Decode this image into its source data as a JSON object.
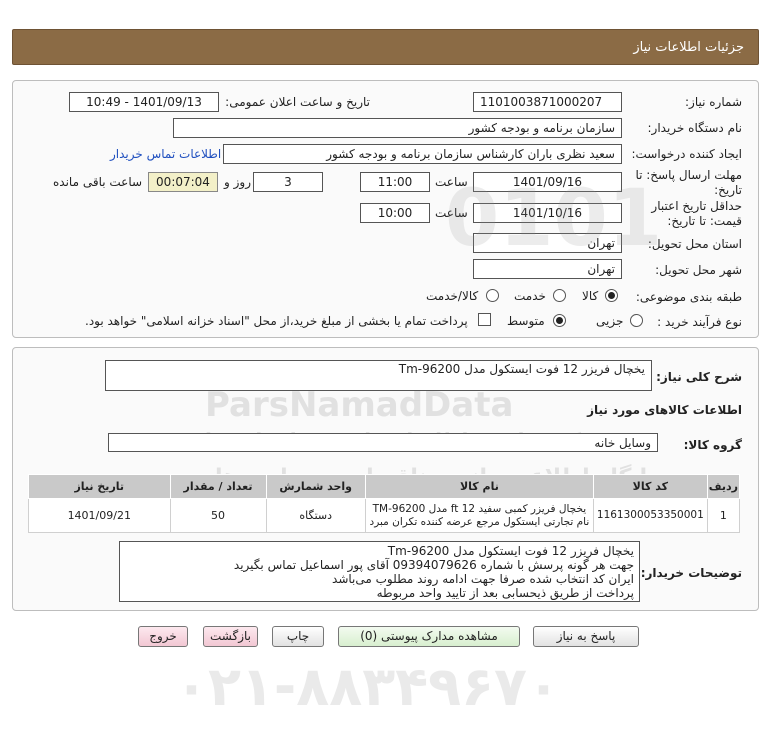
{
  "header": {
    "title": "جزئیات اطلاعات نیاز"
  },
  "form": {
    "need_number_label": "شماره نیاز:",
    "need_number": "1101003871000207",
    "announce_label": "تاریخ و ساعت اعلان عمومی:",
    "announce_value": "1401/09/13 - 10:49",
    "buyer_org_label": "نام دستگاه خریدار:",
    "buyer_org": "سازمان برنامه و بودجه کشور",
    "requester_label": "ایجاد کننده درخواست:",
    "requester": "سعید نظری باران کارشناس سازمان برنامه و بودجه کشور",
    "contact_link": "اطلاعات تماس خریدار",
    "reply_deadline_label": "مهلت ارسال پاسخ: تا تاریخ:",
    "reply_date": "1401/09/16",
    "time_label": "ساعت",
    "reply_time": "11:00",
    "days_value": "3",
    "days_label": "روز و",
    "remaining_time": "00:07:04",
    "remaining_label": "ساعت باقی مانده",
    "validity_label": "حداقل تاریخ اعتبار قیمت: تا تاریخ:",
    "validity_date": "1401/10/16",
    "validity_time_label": "ساعت",
    "validity_time": "10:00",
    "province_label": "استان محل تحویل:",
    "province": "تهران",
    "city_label": "شهر محل تحویل:",
    "city": "تهران",
    "category_label": "طبقه بندی موضوعی:",
    "category_options": [
      "کالا",
      "خدمت",
      "کالا/خدمت"
    ],
    "process_label": "نوع فرآیند خرید :",
    "process_options": [
      "جزیی",
      "متوسط"
    ],
    "payment_note": "پرداخت تمام یا بخشی از مبلغ خرید،از محل \"اسناد خزانه اسلامی\" خواهد بود."
  },
  "details": {
    "summary_label": "شرح کلی نیاز:",
    "summary": "یخچال فریزر 12 فوت ایستکول مدل Tm-96200",
    "goods_info_title": "اطلاعات کالاهای مورد نیاز",
    "goods_group_label": "گروه کالا:",
    "goods_group": "وسایل خانه",
    "table_headers": [
      "ردیف",
      "کد کالا",
      "نام کالا",
      "واحد شمارش",
      "تعداد / مقدار",
      "تاریخ نیاز"
    ],
    "rows": [
      {
        "index": "1",
        "code": "1161300053350001",
        "name": "یخچال فریزر کمبی سفید 12 ft مدل TM-96200 نام تجارتی ایستکول مرجع عرضه کننده تکران مبرد",
        "unit": "دستگاه",
        "qty": "50",
        "date": "1401/09/21"
      }
    ],
    "buyer_notes_label": "توضیحات خریدار:",
    "buyer_notes": [
      "یخچال فریزر 12 فوت ایستکول مدل Tm-96200",
      "جهت هر گونه پرسش با شماره 09394079626 آقای پور اسماعیل تماس بگیرید",
      "ایران کد انتخاب شده صرفا جهت ادامه روند مطلوب می‌باشد",
      "پرداخت از طریق ذیحسابی بعد از تایید واحد مربوطه"
    ]
  },
  "buttons": {
    "reply": "پاسخ به نیاز",
    "attachments": "مشاهده مدارک پیوستی (0)",
    "print": "چاپ",
    "back": "بازگشت",
    "exit": "خروج"
  },
  "watermark": {
    "brand": "ParsNamadData",
    "line1": "مرکز فراوری اطلاعات پارس نماد داده ها",
    "line2": "پایگاه اطلاع رسانی مناقصات و مزایده ها",
    "phone": "۰۲۱-۸۸۳۴۹۶۷۰",
    "digits": "0101"
  },
  "colors": {
    "title_bar": "#8b6b45",
    "table_header": "#c9c9c9",
    "remaining_bg": "#f3f0c8",
    "link": "#1f4fbf"
  }
}
